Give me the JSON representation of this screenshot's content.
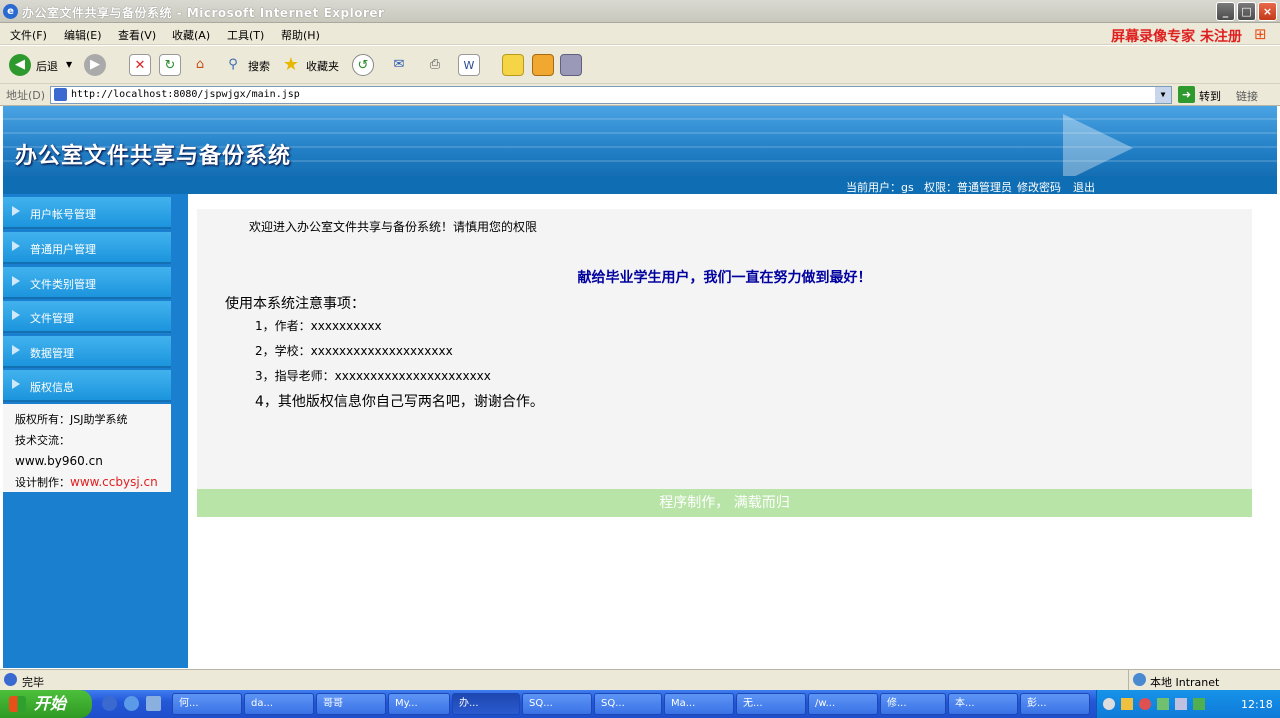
{
  "window": {
    "title": "办公室文件共享与备份系统 - Microsoft Internet Explorer",
    "controls": [
      "_",
      "□",
      "×"
    ]
  },
  "menubar": {
    "items": [
      "文件(F)",
      "编辑(E)",
      "查看(V)",
      "收藏(A)",
      "工具(T)",
      "帮助(H)"
    ],
    "watermark": "屏幕录像专家 未注册"
  },
  "toolbar": {
    "back_label": "后退",
    "search_label": "搜索",
    "favorites_label": "收藏夹"
  },
  "addressbar": {
    "label": "地址(D)",
    "url": "http://localhost:8080/jspwjgx/main.jsp",
    "go_label": "转到",
    "links_label": "链接"
  },
  "site": {
    "title": "办公室文件共享与备份系统",
    "userbar": {
      "current_user": "当前用户：gs",
      "permission": "权限：普通管理员",
      "change_password": "修改密码",
      "logout": "退出"
    }
  },
  "sidebar": {
    "items": [
      {
        "label": "用户帐号管理"
      },
      {
        "label": "普通用户管理"
      },
      {
        "label": "文件类别管理"
      },
      {
        "label": "文件管理"
      },
      {
        "label": "数据管理"
      },
      {
        "label": "版权信息"
      }
    ],
    "copyright": {
      "owner": "版权所有：JSJ助学系统",
      "tech": "技术交流：",
      "site1": "www.by960.cn",
      "designer_label": "设计制作：",
      "designer_site": "www.ccbysj.cn"
    }
  },
  "main": {
    "welcome": "欢迎进入办公室文件共享与备份系统！请慎用您的权限",
    "dedication": "献给毕业学生用户，我们一直在努力做到最好！",
    "notes_title": "使用本系统注意事项：",
    "notes": [
      "1，作者：xxxxxxxxxx",
      "2，学校：xxxxxxxxxxxxxxxxxxxx",
      "3，指导老师：xxxxxxxxxxxxxxxxxxxxxx",
      "4，其他版权信息你自己写两名吧，谢谢合作。"
    ],
    "footer": "程序制作，  满载而归"
  },
  "statusbar": {
    "status": "完毕",
    "zone": "本地 Intranet"
  },
  "taskbar": {
    "start": "开始",
    "tasks": [
      "何...",
      "da...",
      "哥哥",
      "My...",
      "办...",
      "SQ...",
      "SQ...",
      "Ma...",
      "无...",
      "/w...",
      "修...",
      "本...",
      "彭..."
    ],
    "clock": "12:18"
  },
  "colors": {
    "banner": "#1f7cc3",
    "sidebar": "#1a7fcf",
    "dedication": "#0000a0",
    "footer_strip": "#b8e4a8",
    "designer_link": "#e02020"
  }
}
